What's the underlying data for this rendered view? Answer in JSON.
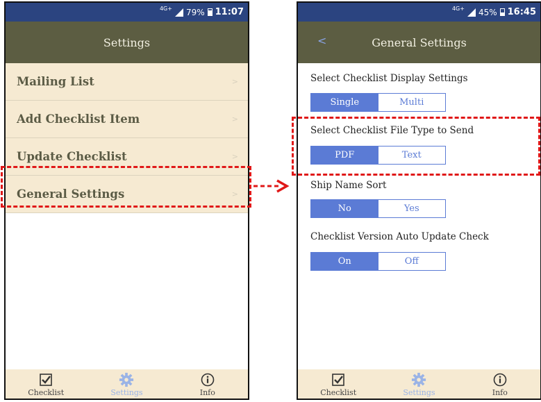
{
  "left_screen": {
    "status": {
      "network": "4G+",
      "battery": "79%",
      "time": "11:07",
      "battery_level": 0.79
    },
    "title": "Settings",
    "menu": [
      {
        "label": "Mailing List",
        "chevron": ">"
      },
      {
        "label": "Add Checklist Item",
        "chevron": ">"
      },
      {
        "label": "Update Checklist",
        "chevron": ">"
      },
      {
        "label": "General Settings",
        "chevron": ">"
      }
    ],
    "tabs": [
      {
        "label": "Checklist",
        "icon": "checkbox-icon"
      },
      {
        "label": "Settings",
        "icon": "gear-icon"
      },
      {
        "label": "Info",
        "icon": "info-icon"
      }
    ]
  },
  "right_screen": {
    "status": {
      "network": "4G+",
      "battery": "45%",
      "time": "16:45",
      "battery_level": 0.45
    },
    "back": "<",
    "title": "General Settings",
    "sections": [
      {
        "label": "Select Checklist Display Settings",
        "options": [
          "Single",
          "Multi"
        ],
        "selected": "Single"
      },
      {
        "label": "Select Checklist File Type to Send",
        "options": [
          "PDF",
          "Text"
        ],
        "selected": "PDF"
      },
      {
        "label": "Ship Name Sort",
        "options": [
          "No",
          "Yes"
        ],
        "selected": "No"
      },
      {
        "label": "Checklist Version Auto Update Check",
        "options": [
          "On",
          "Off"
        ],
        "selected": "On"
      }
    ],
    "tabs": [
      {
        "label": "Checklist",
        "icon": "checkbox-icon"
      },
      {
        "label": "Settings",
        "icon": "gear-icon"
      },
      {
        "label": "Info",
        "icon": "info-icon"
      }
    ]
  },
  "colors": {
    "status_bar": "#2b4480",
    "nav_bar": "#5c5d42",
    "menu_bg": "#f6ead2",
    "segment_accent": "#5b7bd5",
    "highlight": "#e01818"
  }
}
